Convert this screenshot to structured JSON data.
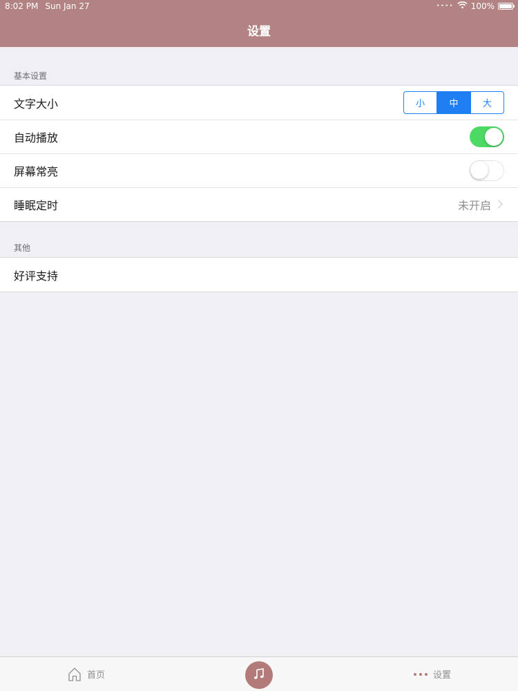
{
  "status_bar": {
    "time": "8:02 PM",
    "date": "Sun Jan 27",
    "battery": "100%"
  },
  "nav": {
    "title": "设置"
  },
  "sections": {
    "basic": {
      "header": "基本设置",
      "font_size": {
        "label": "文字大小",
        "options": [
          "小",
          "中",
          "大"
        ],
        "selected": "中"
      },
      "autoplay": {
        "label": "自动播放",
        "on": true
      },
      "keep_screen_on": {
        "label": "屏幕常亮",
        "on": false
      },
      "sleep_timer": {
        "label": "睡眠定时",
        "value": "未开启"
      }
    },
    "other": {
      "header": "其他",
      "rate_app": {
        "label": "好评支持"
      }
    }
  },
  "tab_bar": {
    "home_label": "首页",
    "settings_label": "设置"
  },
  "colors": {
    "header_bg": "#b38383",
    "accent_blue": "#1e7ef2",
    "toggle_on": "#4cd964",
    "tab_accent": "#b37a7a"
  },
  "icons": {
    "wifi": "wifi-icon",
    "battery": "battery-icon",
    "chevron": "chevron-right-icon",
    "home": "home-icon",
    "music": "music-note-icon",
    "more": "more-dots-icon"
  }
}
